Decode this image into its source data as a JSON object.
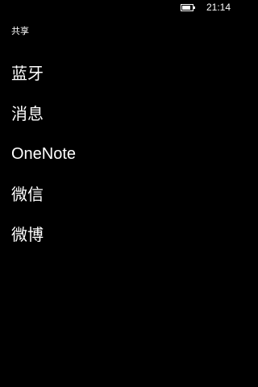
{
  "status_bar": {
    "time": "21:14",
    "battery_icon": "battery-icon"
  },
  "header": {
    "title": "共享"
  },
  "share_targets": [
    {
      "label": "蓝牙"
    },
    {
      "label": "消息"
    },
    {
      "label": "OneNote"
    },
    {
      "label": "微信"
    },
    {
      "label": "微博"
    }
  ],
  "colors": {
    "background": "#000000",
    "text": "#ffffff"
  }
}
